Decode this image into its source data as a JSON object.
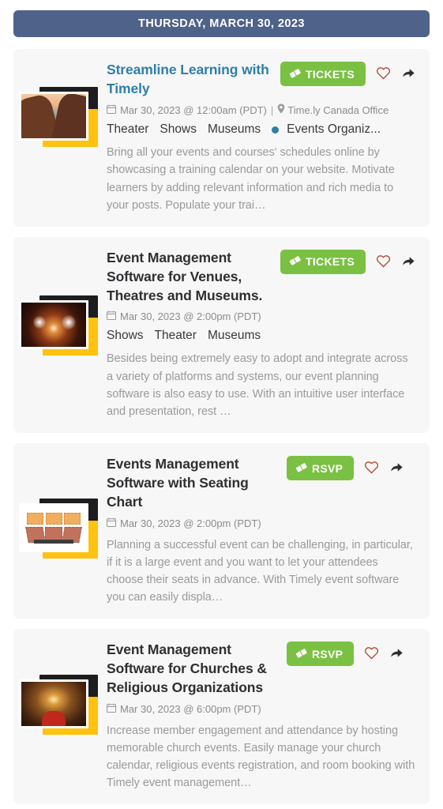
{
  "header": {
    "date_label": "THURSDAY, MARCH 30, 2023",
    "bar_color": "#4f6289"
  },
  "theme": {
    "cta_green": "#7ac143",
    "link_blue": "#2f7fa6",
    "heart_red": "#b5442a",
    "card_bg": "#f7f7f7",
    "page_bg": "#ffffff",
    "frame_yellow": "#ffc20e",
    "frame_black": "#1d1d1f"
  },
  "icons": {
    "calendar": "calendar-icon",
    "pin": "map-pin-icon",
    "ticket": "ticket-icon",
    "heart": "heart-icon",
    "share": "share-icon"
  },
  "events": [
    {
      "title": "Streamline Learning with Timely",
      "title_is_link": true,
      "date": "Mar 30, 2023 @ 12:00am (PDT)",
      "separator": "|",
      "venue": "Time.ly Canada Office",
      "has_venue": true,
      "tags": [
        "Theater",
        "Shows",
        "Museums"
      ],
      "taxonomy": "Events Organiz...",
      "has_taxonomy": true,
      "cta_label": "TICKETS",
      "excerpt": "Bring all your events and courses' schedules online by showcasing a training calendar on your website. Motivate learners by adding relevant information and rich media to your posts. Populate your trai…",
      "thumbnail": "hands-framing-sunset-photo"
    },
    {
      "title": "Event Management Software for Venues, Theatres and Museums.",
      "title_is_link": false,
      "date": "Mar 30, 2023 @ 2:00pm (PDT)",
      "separator": "",
      "venue": "",
      "has_venue": false,
      "tags": [
        "Shows",
        "Theater",
        "Museums"
      ],
      "taxonomy": "",
      "has_taxonomy": false,
      "cta_label": "TICKETS",
      "excerpt": "Besides being extremely easy to adopt and integrate across a variety of platforms and systems, our event planning software is also easy to use. With an intuitive user interface and presentation, rest …",
      "thumbnail": "concert-stage-lights-photo"
    },
    {
      "title": "Events Management Software with Seating Chart",
      "title_is_link": false,
      "date": "Mar 30, 2023 @ 2:00pm (PDT)",
      "separator": "",
      "venue": "",
      "has_venue": false,
      "tags": [],
      "taxonomy": "",
      "has_taxonomy": false,
      "cta_label": "RSVP",
      "excerpt": "Planning a successful event can be challenging, in particular, if it is a large event and you want to let your attendees choose their seats in advance. With Timely event software you can easily displa…",
      "thumbnail": "seating-chart-diagram"
    },
    {
      "title": "Event Management Software for Churches & Religious Organizations",
      "title_is_link": false,
      "date": "Mar 30, 2023 @ 6:00pm (PDT)",
      "separator": "",
      "venue": "",
      "has_venue": false,
      "tags": [],
      "taxonomy": "",
      "has_taxonomy": false,
      "cta_label": "RSVP",
      "excerpt": "Increase member engagement and attendance by hosting memorable church events. Easily manage your church calendar, religious events registration, and room booking with Timely event management…",
      "thumbnail": "church-interior-photo"
    }
  ]
}
